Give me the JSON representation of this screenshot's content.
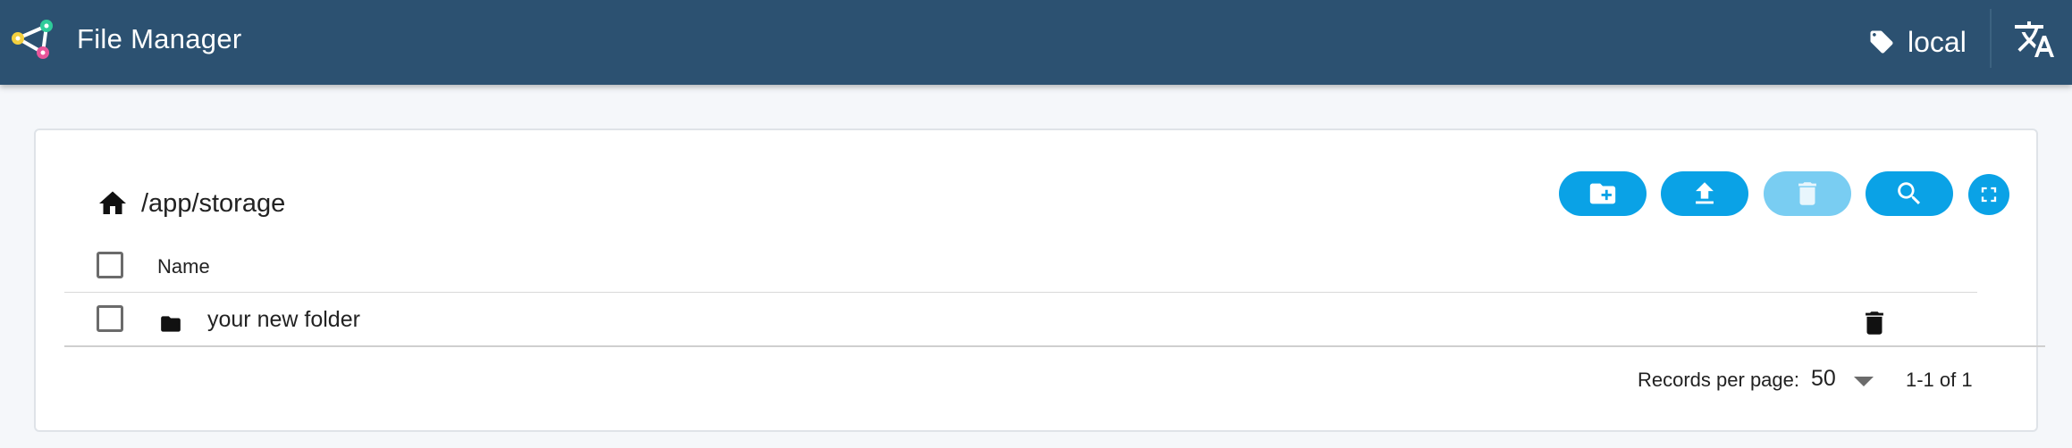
{
  "header": {
    "app_title": "File Manager",
    "storage_label": "local",
    "icons": {
      "logo": "app-logo",
      "tag": "tag-icon",
      "language": "translate-icon"
    },
    "bg_color": "#2c5171"
  },
  "browser": {
    "path": "/app/storage",
    "toolbar": {
      "new_folder": "folder-plus-icon",
      "upload": "upload-icon",
      "delete": "delete-icon",
      "search": "search-icon",
      "fullscreen": "fullscreen-icon"
    },
    "accent_color": "#0aa2e6",
    "table": {
      "columns": [
        "Name"
      ],
      "rows": [
        {
          "name": "your new folder",
          "type": "folder"
        }
      ]
    },
    "pagination": {
      "records_per_page_label": "Records per page:",
      "records_per_page": "50",
      "range": "1-1 of 1"
    }
  }
}
